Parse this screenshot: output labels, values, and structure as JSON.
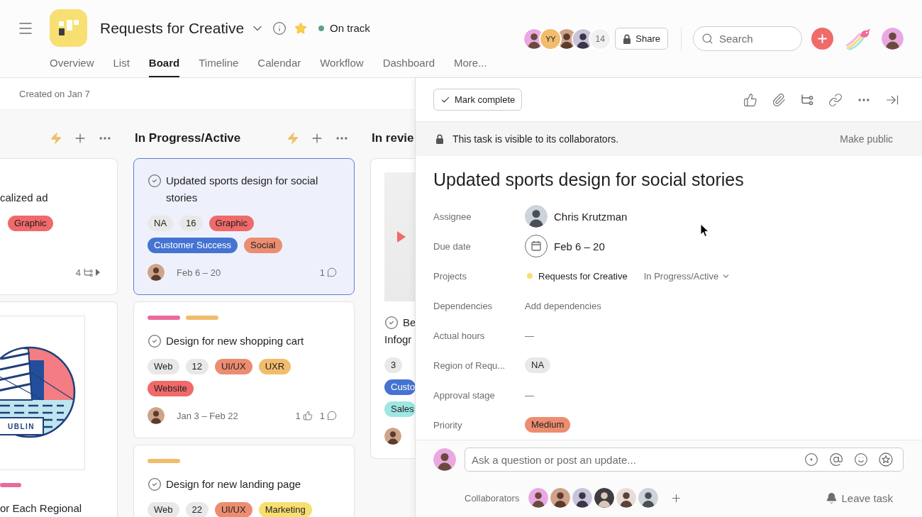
{
  "project": {
    "title": "Requests for Creative",
    "favorite": true,
    "status": {
      "label": "On track",
      "kind": "on_track"
    }
  },
  "tabs": [
    {
      "label": "Overview",
      "selected": false
    },
    {
      "label": "List",
      "selected": false
    },
    {
      "label": "Board",
      "selected": true
    },
    {
      "label": "Timeline",
      "selected": false
    },
    {
      "label": "Calendar",
      "selected": false
    },
    {
      "label": "Workflow",
      "selected": false
    },
    {
      "label": "Dashboard",
      "selected": false
    },
    {
      "label": "More...",
      "selected": false
    }
  ],
  "members": {
    "avatars": [
      {
        "kind": "photo"
      },
      {
        "kind": "initials",
        "initials": "YY",
        "color": "#f1bd6c"
      },
      {
        "kind": "photo"
      },
      {
        "kind": "photo"
      }
    ],
    "count": "14"
  },
  "share_button": "Share",
  "search": {
    "placeholder": "Search"
  },
  "created_note": "Created on Jan 7",
  "board": {
    "columns": [
      {
        "kind": "cut_left",
        "cards": [
          {
            "title": "calized ad",
            "selected": false,
            "tags": [
              {
                "label": "Graphic",
                "color": "#f06a6a"
              }
            ],
            "subtasks": "4"
          },
          {
            "image": {
              "label": "UBLIN"
            },
            "color_bars": [
              {
                "color": "#ea6aa0"
              }
            ],
            "title": "or Each Regional",
            "selected": false
          }
        ]
      },
      {
        "kind": "full",
        "title": "In Progress/Active",
        "cards": [
          {
            "title": "Updated sports design for social stories",
            "completed": false,
            "selected": true,
            "tags": [
              {
                "label": "NA",
                "color": "#e8e8e8"
              },
              {
                "label": "16",
                "color": "#e8e8e8"
              },
              {
                "label": "Graphic",
                "color": "#f06a6a"
              },
              {
                "label": "Customer Success",
                "color": "#4573d2"
              },
              {
                "label": "Social",
                "color": "#ec8d71"
              }
            ],
            "assignee": {
              "kind": "photo"
            },
            "dates": "Feb 6 – 20",
            "comments": "1"
          },
          {
            "color_bars": [
              {
                "color": "#ea6a9c"
              },
              {
                "color": "#f1bd6c"
              }
            ],
            "title": "Design for new shopping cart",
            "completed": false,
            "selected": false,
            "tags": [
              {
                "label": "Web",
                "color": "#e8e8e8"
              },
              {
                "label": "12",
                "color": "#e8e8e8"
              },
              {
                "label": "UI/UX",
                "color": "#ec8d71"
              },
              {
                "label": "UXR",
                "color": "#f1bd6c"
              },
              {
                "label": "Website",
                "color": "#f06a6a"
              }
            ],
            "assignee": {
              "kind": "photo"
            },
            "dates": "Jan 3 – Feb 22",
            "likes": "1",
            "comments": "1"
          },
          {
            "color_bars": [
              {
                "color": "#f1bd6c"
              }
            ],
            "title": "Design for new landing page",
            "completed": false,
            "selected": false,
            "tags": [
              {
                "label": "Web",
                "color": "#e8e8e8"
              },
              {
                "label": "22",
                "color": "#e8e8e8"
              },
              {
                "label": "UI/UX",
                "color": "#ec8d71"
              },
              {
                "label": "Marketing",
                "color": "#f8df72"
              }
            ]
          }
        ]
      },
      {
        "kind": "cut_right",
        "title": "In revie",
        "cards": [
          {
            "cover": {
              "kind": "video"
            },
            "title_lines": [
              "Be",
              "Infogr"
            ],
            "completed": false,
            "selected": false,
            "tags": [
              {
                "label": "3",
                "color": "#e8e8e8"
              },
              {
                "label": "Custo",
                "color": "#4573d2"
              },
              {
                "label": "Sales",
                "color": "#9ee7e3"
              }
            ],
            "assignee": {
              "kind": "photo"
            }
          }
        ]
      }
    ]
  },
  "task": {
    "mark_complete": "Mark complete",
    "privacy_note": "This task is visible to its collaborators.",
    "make_public": "Make public",
    "title": "Updated sports design for social stories",
    "fields": [
      {
        "label": "Assignee",
        "kind": "person",
        "value": "Chris Krutzman"
      },
      {
        "label": "Due date",
        "kind": "date",
        "value": "Feb 6 – 20"
      },
      {
        "label": "Projects",
        "kind": "project",
        "value": "Requests for Creative",
        "color": "#f8df72",
        "section": "In Progress/Active"
      },
      {
        "label": "Dependencies",
        "kind": "action",
        "value": "Add dependencies"
      },
      {
        "label": "Actual hours",
        "kind": "text",
        "value": "—"
      },
      {
        "label": "Region of Requ...",
        "kind": "tag",
        "value": "NA",
        "color": "#e8e8e8"
      },
      {
        "label": "Approval stage",
        "kind": "text",
        "value": "—"
      },
      {
        "label": "Priority",
        "kind": "tag",
        "value": "Medium",
        "color": "#ec8d71"
      }
    ]
  },
  "composer": {
    "placeholder": "Ask a question or post an update...",
    "collaborators_label": "Collaborators",
    "collaborators": [
      {
        "kind": "photo"
      },
      {
        "kind": "photo"
      },
      {
        "kind": "photo"
      },
      {
        "kind": "photo"
      },
      {
        "kind": "photo"
      },
      {
        "kind": "photo"
      }
    ],
    "leave_task": "Leave task"
  }
}
